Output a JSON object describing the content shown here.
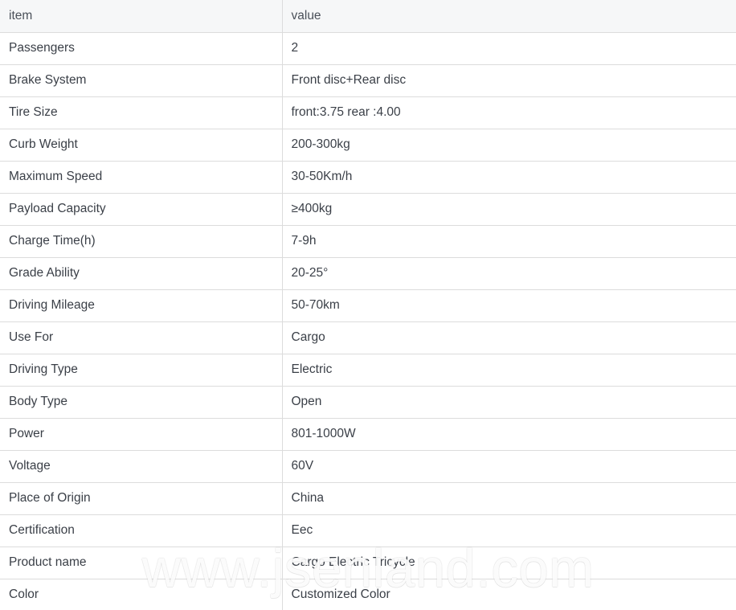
{
  "table": {
    "headers": {
      "item": "item",
      "value": "value"
    },
    "rows": [
      {
        "item": "Passengers",
        "value": "2"
      },
      {
        "item": "Brake System",
        "value": "Front disc+Rear disc"
      },
      {
        "item": "Tire Size",
        "value": "front:3.75 rear :4.00"
      },
      {
        "item": "Curb Weight",
        "value": "200-300kg"
      },
      {
        "item": "Maximum Speed",
        "value": "30-50Km/h"
      },
      {
        "item": "Payload Capacity",
        "value": "≥400kg"
      },
      {
        "item": "Charge Time(h)",
        "value": "7-9h"
      },
      {
        "item": "Grade Ability",
        "value": "20-25°"
      },
      {
        "item": "Driving Mileage",
        "value": "50-70km"
      },
      {
        "item": "Use For",
        "value": "Cargo"
      },
      {
        "item": "Driving Type",
        "value": "Electric"
      },
      {
        "item": "Body Type",
        "value": "Open"
      },
      {
        "item": "Power",
        "value": "801-1000W"
      },
      {
        "item": "Voltage",
        "value": "60V"
      },
      {
        "item": "Place of Origin",
        "value": "China"
      },
      {
        "item": "Certification",
        "value": "Eec"
      },
      {
        "item": "Product name",
        "value": "Cargo Electric Tricycle"
      },
      {
        "item": "Color",
        "value": "Customized Color"
      }
    ]
  },
  "watermark": {
    "text": "www.jsenland.com"
  },
  "colors": {
    "header_background": "#f6f7f8",
    "border": "#dcdcdc",
    "text": "#3a3f47",
    "page_background": "#ffffff"
  }
}
